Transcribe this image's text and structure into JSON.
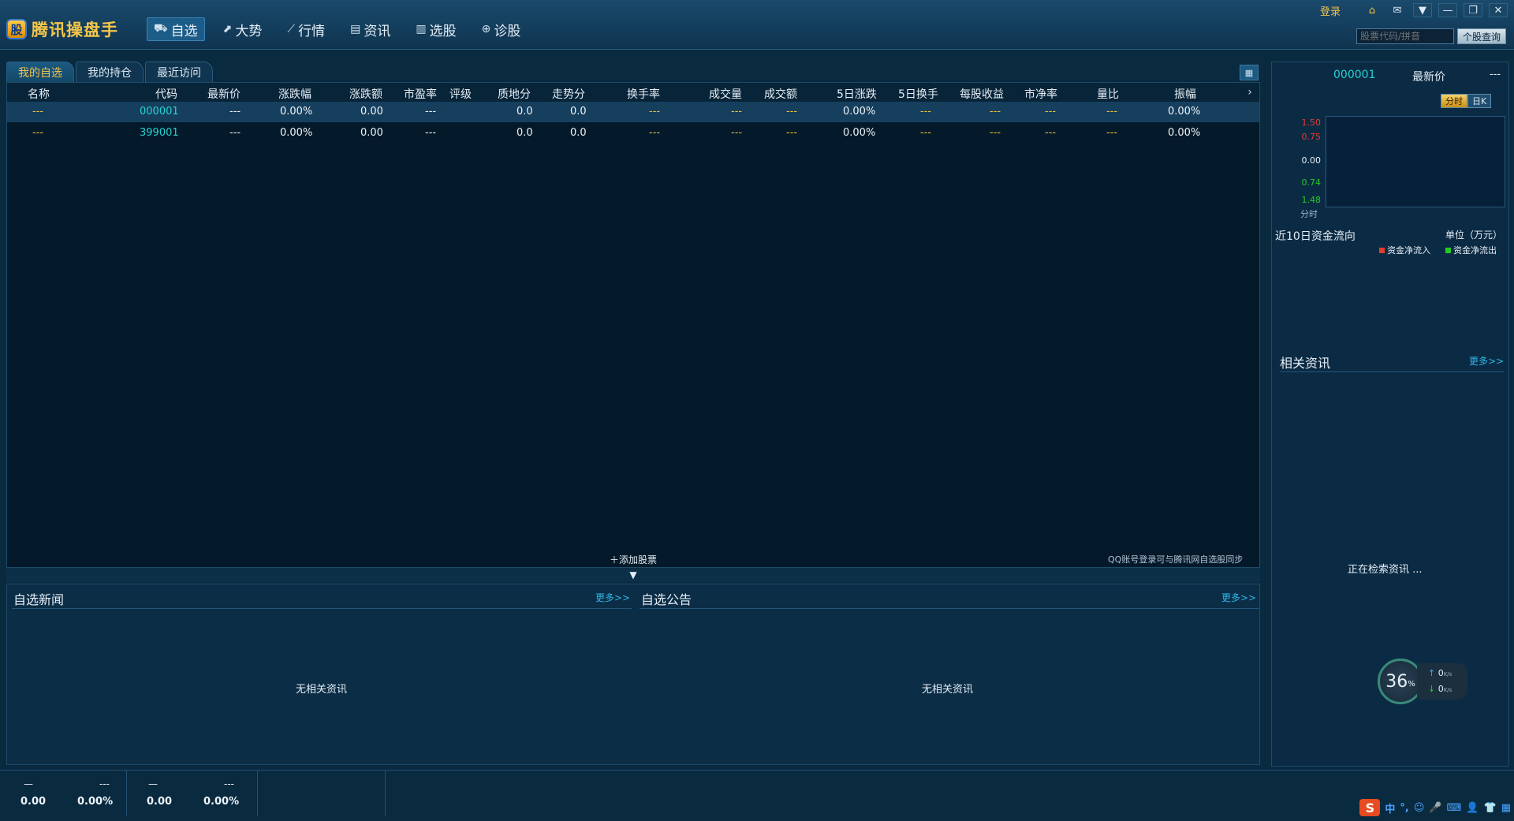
{
  "app": {
    "logo_glyph": "股",
    "title": "腾讯操盘手",
    "login_label": "登录",
    "colors": {
      "accent": "#f3c24a",
      "code": "#25d2d2",
      "link": "#2fb7e8",
      "inflow": "#e63b2e",
      "outflow": "#22cc22"
    }
  },
  "nav": [
    {
      "label": "自选",
      "icon": "cart-icon",
      "active": true
    },
    {
      "label": "大势",
      "icon": "trend-icon"
    },
    {
      "label": "行情",
      "icon": "line-chart-icon"
    },
    {
      "label": "资讯",
      "icon": "news-icon"
    },
    {
      "label": "选股",
      "icon": "bar-chart-icon"
    },
    {
      "label": "诊股",
      "icon": "diagnose-icon"
    }
  ],
  "search": {
    "placeholder": "股票代码/拼音",
    "button": "个股查询"
  },
  "tabs": [
    "我的自选",
    "我的持仓",
    "最近访问"
  ],
  "table": {
    "columns": [
      "名称",
      "代码",
      "最新价",
      "涨跌幅",
      "涨跌额",
      "市盈率",
      "评级",
      "质地分",
      "走势分",
      "换手率",
      "成交量",
      "成交额",
      "5日涨跌",
      "5日换手",
      "每股收益",
      "市净率",
      "量比",
      "振幅"
    ],
    "rows": [
      [
        "---",
        "000001",
        "---",
        "0.00%",
        "0.00",
        "---",
        "",
        "0.0",
        "0.0",
        "---",
        "---",
        "---",
        "0.00%",
        "---",
        "---",
        "---",
        "---",
        "0.00%"
      ],
      [
        "---",
        "399001",
        "---",
        "0.00%",
        "0.00",
        "---",
        "",
        "0.0",
        "0.0",
        "---",
        "---",
        "---",
        "0.00%",
        "---",
        "---",
        "---",
        "---",
        "0.00%"
      ]
    ],
    "add_label": "添加股票",
    "sync_note": "QQ账号登录可与腾讯网自选股同步"
  },
  "news": {
    "left": {
      "title": "自选新闻",
      "more": "更多>>",
      "empty": "无相关资讯"
    },
    "right": {
      "title": "自选公告",
      "more": "更多>>",
      "empty": "无相关资讯"
    }
  },
  "status_indices": [
    {
      "name": "—",
      "change": "---",
      "value": "0.00",
      "pct": "0.00%"
    },
    {
      "name": "—",
      "change": "---",
      "value": "0.00",
      "pct": "0.00%"
    }
  ],
  "right_panel": {
    "code": "000001",
    "price_label": "最新价",
    "price": "---",
    "chart_tabs": [
      "分时",
      "日K"
    ],
    "y_labels": [
      "1.50",
      "0.75",
      "0.00",
      "0.74",
      "1.48"
    ],
    "chart_caption": "分时",
    "flow_title": "近10日资金流向",
    "flow_unit": "单位（万元）",
    "legend_in": "资金净流入",
    "legend_out": "资金净流出",
    "related_title": "相关资讯",
    "related_more": "更多>>",
    "searching": "正在检索资讯 ..."
  },
  "network": {
    "cpu_value": "36",
    "cpu_unit": "%",
    "up": "0",
    "down": "0",
    "unit": "K/s"
  }
}
